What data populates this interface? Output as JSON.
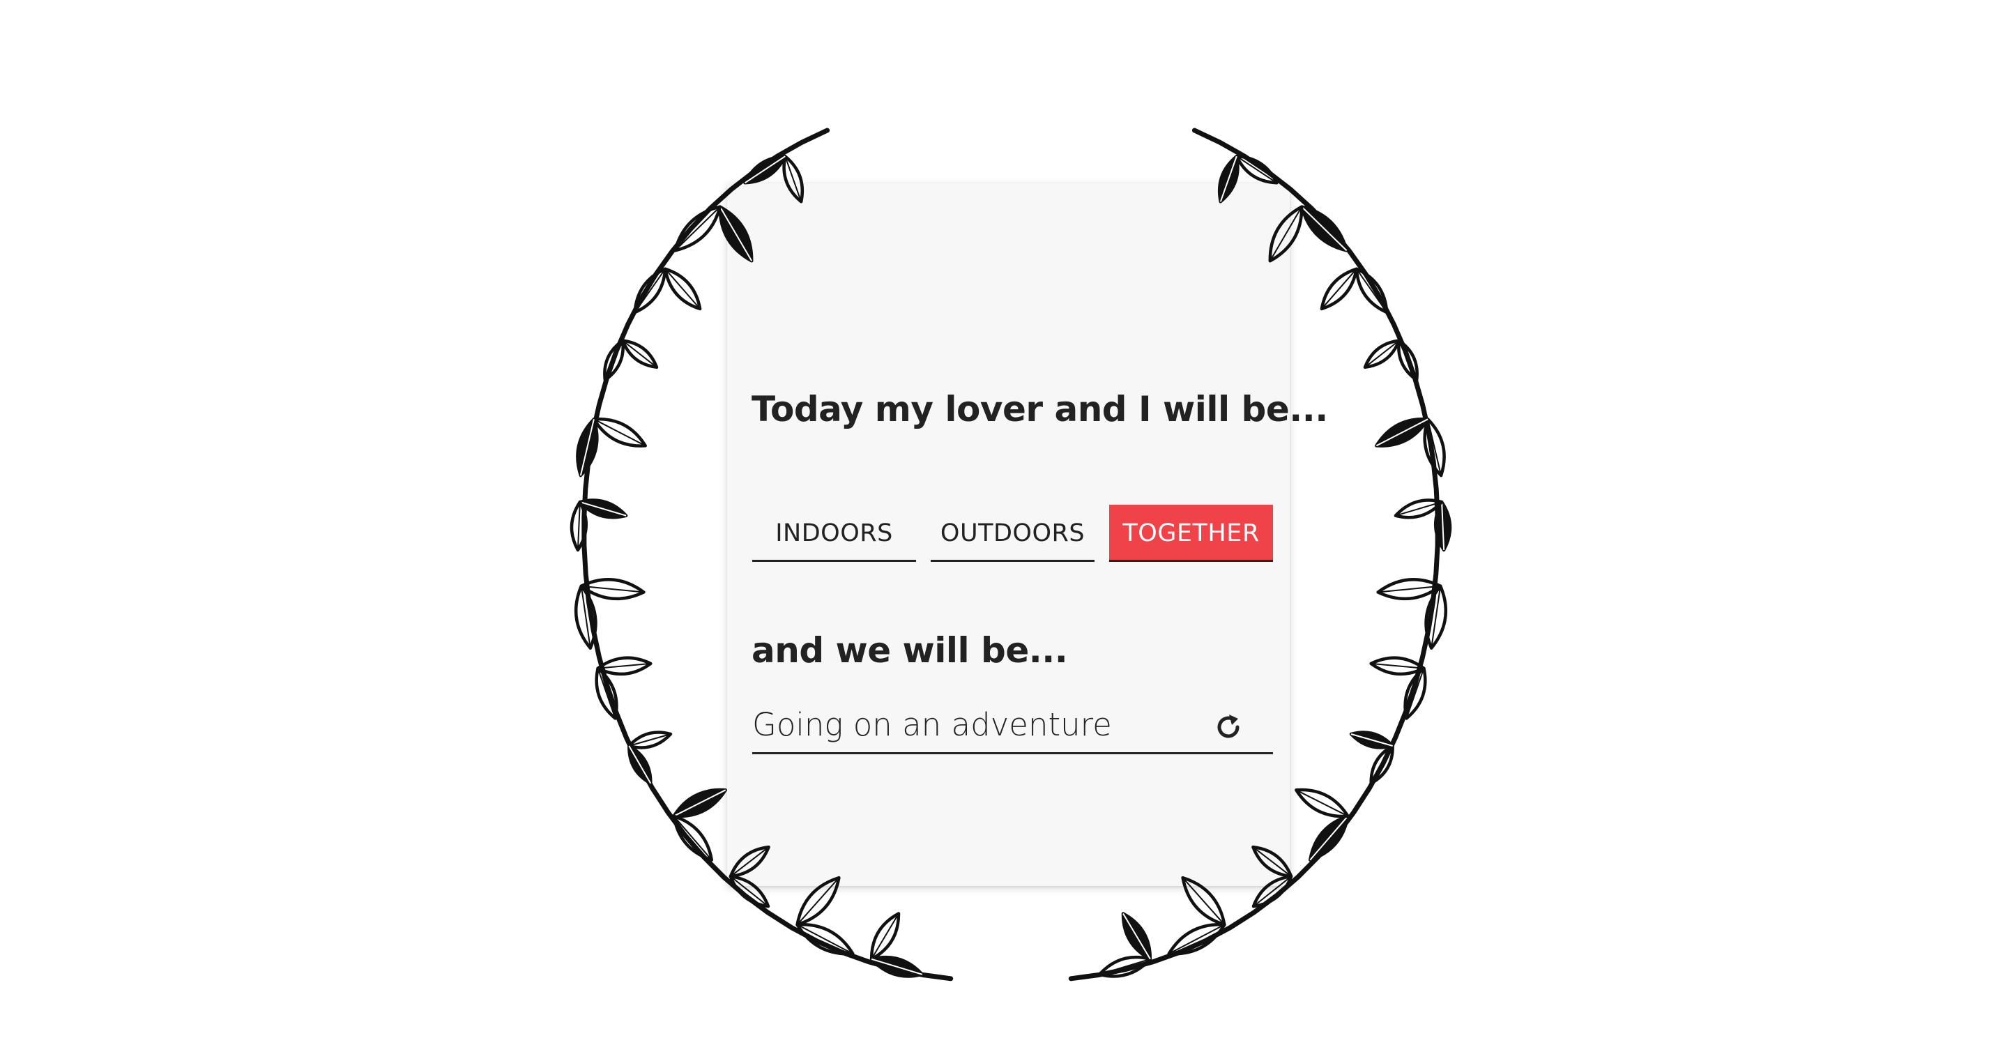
{
  "prompt": {
    "title": "Today my lover and I will be..."
  },
  "tabs": [
    {
      "label": "INDOORS",
      "active": false
    },
    {
      "label": "OUTDOORS",
      "active": false
    },
    {
      "label": "TOGETHER",
      "active": true
    }
  ],
  "result": {
    "title": "and we will be...",
    "activity": "Going on an adventure"
  },
  "icons": {
    "refresh": "refresh-icon",
    "wreath": "leaf-wreath-illustration"
  },
  "colors": {
    "accent": "#ef4249",
    "card_background": "#f7f7f7",
    "text": "#222222",
    "page_background": "#ffffff"
  }
}
